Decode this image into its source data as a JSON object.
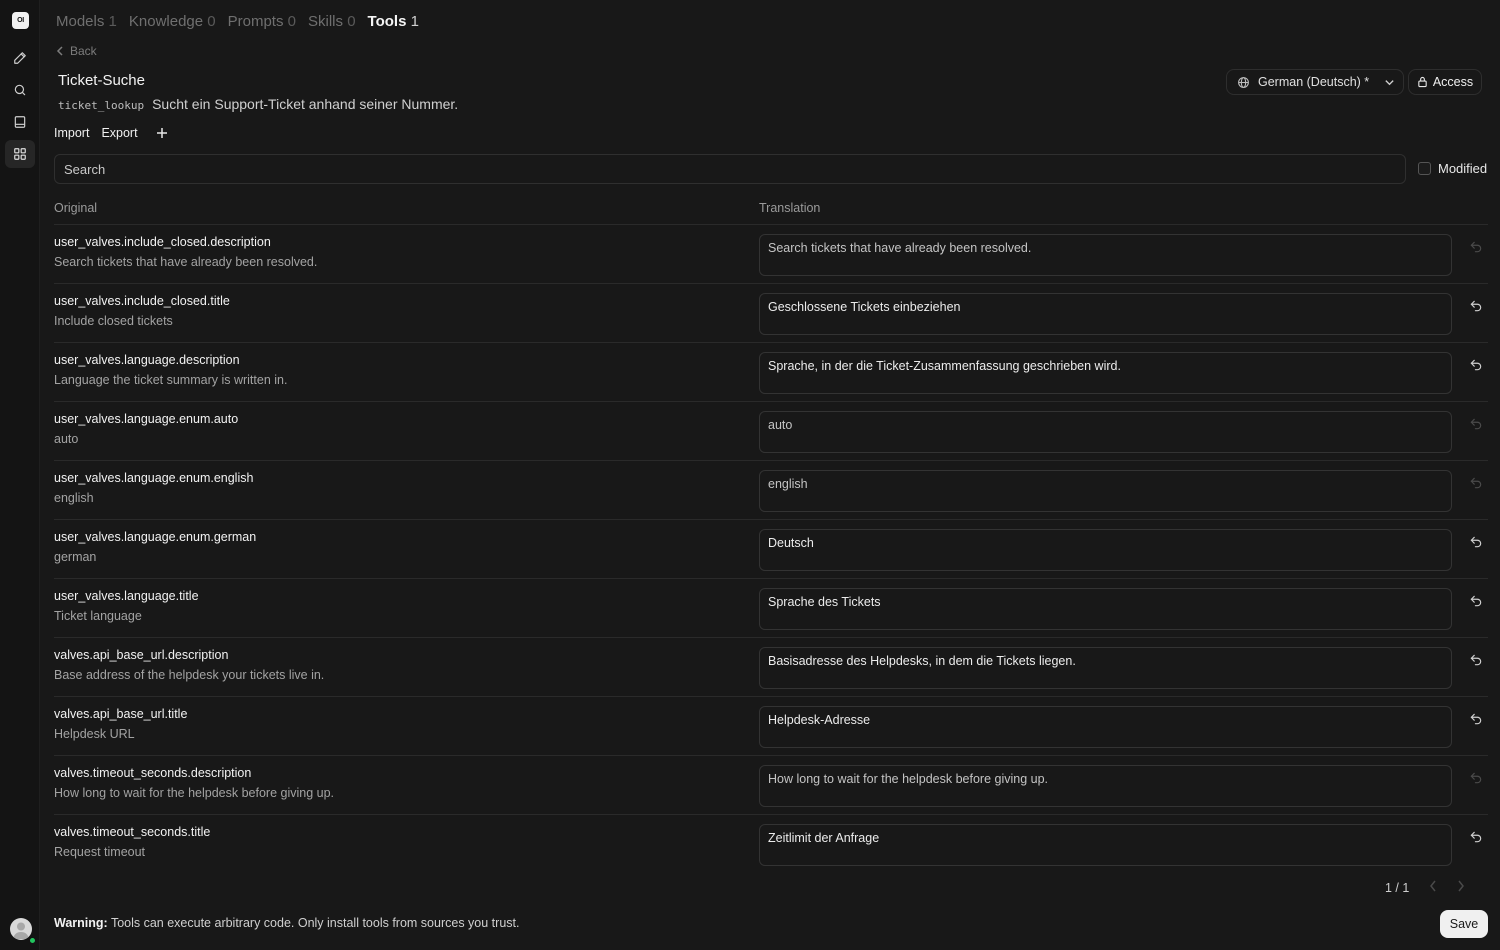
{
  "app": {
    "logo_text": "OI"
  },
  "sidebar": {
    "icons": [
      "pencil-icon",
      "search-icon",
      "notebook-icon",
      "workspace-grid-icon"
    ],
    "active": "workspace-grid-icon"
  },
  "tabs": [
    {
      "label": "Models",
      "count": "1",
      "active": false
    },
    {
      "label": "Knowledge",
      "count": "0",
      "active": false
    },
    {
      "label": "Prompts",
      "count": "0",
      "active": false
    },
    {
      "label": "Skills",
      "count": "0",
      "active": false
    },
    {
      "label": "Tools",
      "count": "1",
      "active": true
    }
  ],
  "back_label": "Back",
  "tool": {
    "name": "Ticket-Suche",
    "id": "ticket_lookup",
    "description": "Sucht ein Support-Ticket anhand seiner Nummer."
  },
  "language_select": {
    "value": "German (Deutsch) *",
    "icon": "globe-icon"
  },
  "access_label": "Access",
  "toolbar": {
    "import_label": "Import",
    "export_label": "Export"
  },
  "search": {
    "placeholder": "Search",
    "value": ""
  },
  "modified_label": "Modified",
  "modified_checked": false,
  "columns": {
    "original": "Original",
    "translation": "Translation"
  },
  "rows": [
    {
      "key": "user_valves.include_closed.description",
      "original": "Search tickets that have already been resolved.",
      "translation": "Search tickets that have already been resolved.",
      "translated": false
    },
    {
      "key": "user_valves.include_closed.title",
      "original": "Include closed tickets",
      "translation": "Geschlossene Tickets einbeziehen",
      "translated": true
    },
    {
      "key": "user_valves.language.description",
      "original": "Language the ticket summary is written in.",
      "translation": "Sprache, in der die Ticket-Zusammenfassung geschrieben wird.",
      "translated": true
    },
    {
      "key": "user_valves.language.enum.auto",
      "original": "auto",
      "translation": "auto",
      "translated": false
    },
    {
      "key": "user_valves.language.enum.english",
      "original": "english",
      "translation": "english",
      "translated": false
    },
    {
      "key": "user_valves.language.enum.german",
      "original": "german",
      "translation": "Deutsch",
      "translated": true
    },
    {
      "key": "user_valves.language.title",
      "original": "Ticket language",
      "translation": "Sprache des Tickets",
      "translated": true
    },
    {
      "key": "valves.api_base_url.description",
      "original": "Base address of the helpdesk your tickets live in.",
      "translation": "Basisadresse des Helpdesks, in dem die Tickets liegen.",
      "translated": true
    },
    {
      "key": "valves.api_base_url.title",
      "original": "Helpdesk URL",
      "translation": "Helpdesk-Adresse",
      "translated": true
    },
    {
      "key": "valves.timeout_seconds.description",
      "original": "How long to wait for the helpdesk before giving up.",
      "translation": "How long to wait for the helpdesk before giving up.",
      "translated": false
    },
    {
      "key": "valves.timeout_seconds.title",
      "original": "Request timeout",
      "translation": "Zeitlimit der Anfrage",
      "translated": true
    }
  ],
  "pagination": {
    "label": "1 / 1"
  },
  "footer": {
    "warning_label": "Warning:",
    "warning_text": "Tools can execute arbitrary code. Only install tools from sources you trust.",
    "save_label": "Save"
  },
  "colors": {
    "background": "#181818",
    "rail": "#141414",
    "online": "#22c55e",
    "save_button": "#f0f0f0"
  }
}
